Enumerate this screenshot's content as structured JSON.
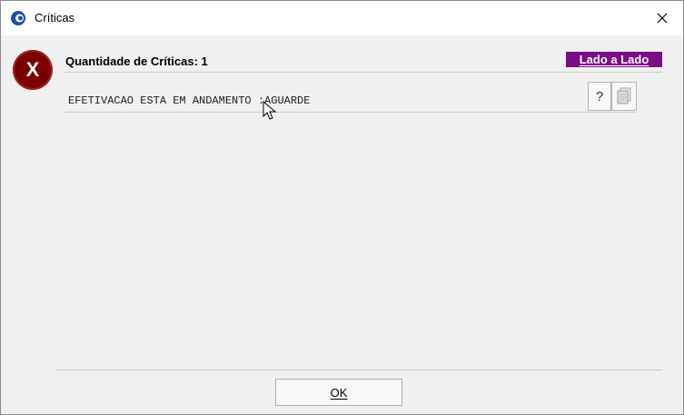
{
  "window": {
    "title": "Críticas",
    "icons": {
      "app": "app-logo-icon",
      "close": "close-icon"
    }
  },
  "error": {
    "icon_glyph": "X",
    "icon_name": "error-icon",
    "color": "#7a0000"
  },
  "header": {
    "count_label": "Quantidade de Críticas: 1",
    "side_by_side_label": "Lado a Lado",
    "side_by_side_color": "#7b0d87"
  },
  "message": {
    "text": "EFETIVACAO ESTA EM ANDAMENTO :AGUARDE",
    "help_label": "?",
    "copy_icon": "copy-document-icon"
  },
  "footer": {
    "ok_label": "OK"
  }
}
